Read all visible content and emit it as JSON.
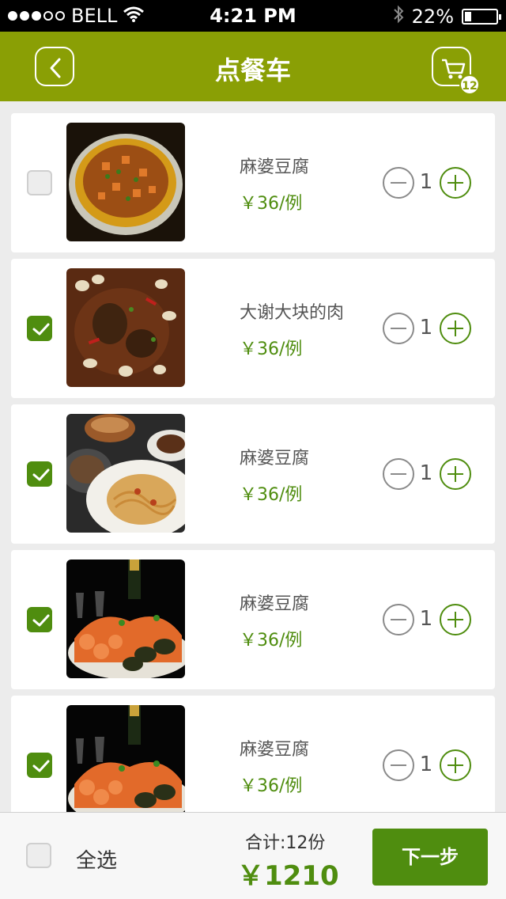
{
  "status_bar": {
    "carrier": "BELL",
    "time": "4:21 PM",
    "battery": "22%",
    "battery_level": 0.22,
    "signal_bars_filled": 3,
    "signal_bars_total": 5,
    "icons": [
      "wifi-icon",
      "bluetooth-icon",
      "battery-icon"
    ]
  },
  "nav": {
    "title": "点餐车",
    "cart_count": "12",
    "icons": [
      "back-icon",
      "cart-icon"
    ]
  },
  "items": [
    {
      "name": "麻婆豆腐",
      "price": "￥36/例",
      "qty": "1",
      "checked": false
    },
    {
      "name": "大谢大块的肉",
      "price": "￥36/例",
      "qty": "1",
      "checked": true
    },
    {
      "name": "麻婆豆腐",
      "price": "￥36/例",
      "qty": "1",
      "checked": true
    },
    {
      "name": "麻婆豆腐",
      "price": "￥36/例",
      "qty": "1",
      "checked": true
    },
    {
      "name": "麻婆豆腐",
      "price": "￥36/例",
      "qty": "1",
      "checked": true
    }
  ],
  "bottom": {
    "select_all": "全选",
    "summary": "合计:12份",
    "total": "￥1210",
    "next": "下一步"
  },
  "colors": {
    "nav_bg": "#8a9f05",
    "accent": "#4f8d0f"
  }
}
